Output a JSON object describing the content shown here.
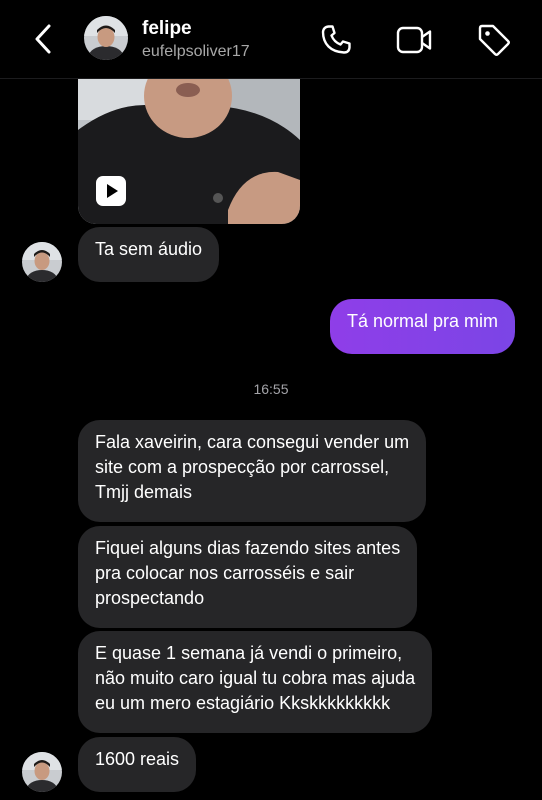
{
  "header": {
    "name": "felipe",
    "username": "eufelpsoliver17",
    "back_icon": "chevron-left-icon",
    "call_icon": "phone-icon",
    "video_icon": "video-camera-icon",
    "tag_icon": "tag-icon"
  },
  "messages": [
    {
      "id": "video-message",
      "type": "video",
      "sender": "felipe",
      "icon": "play-icon"
    },
    {
      "id": "in-1",
      "sender": "felipe",
      "lines": [
        "Ta sem áudio"
      ]
    },
    {
      "id": "out-1",
      "sender": "me",
      "lines": [
        "Tá normal pra mim"
      ]
    },
    {
      "id": "time-1",
      "type": "timestamp",
      "text": "16:55"
    },
    {
      "id": "in-2",
      "sender": "felipe",
      "lines": [
        "Fala xaveirin, cara consegui vender um",
        "site com a prospecção por carrossel,",
        "Tmjj demais"
      ]
    },
    {
      "id": "in-3",
      "sender": "felipe",
      "lines": [
        "Fiquei alguns dias fazendo sites antes",
        "pra colocar nos carrosséis e sair",
        "prospectando"
      ]
    },
    {
      "id": "in-4",
      "sender": "felipe",
      "lines": [
        "E quase 1 semana já vendi o primeiro,",
        "não muito caro igual tu cobra mas ajuda",
        "eu um mero estagiário Kkskkkkkkkkk"
      ]
    },
    {
      "id": "in-5",
      "sender": "felipe",
      "lines": [
        "1600 reais"
      ]
    }
  ],
  "colors": {
    "background": "#000000",
    "incoming_bubble": "#262628",
    "outgoing_bubble": "#8a3fe0",
    "secondary_text": "#a8a8a8"
  }
}
